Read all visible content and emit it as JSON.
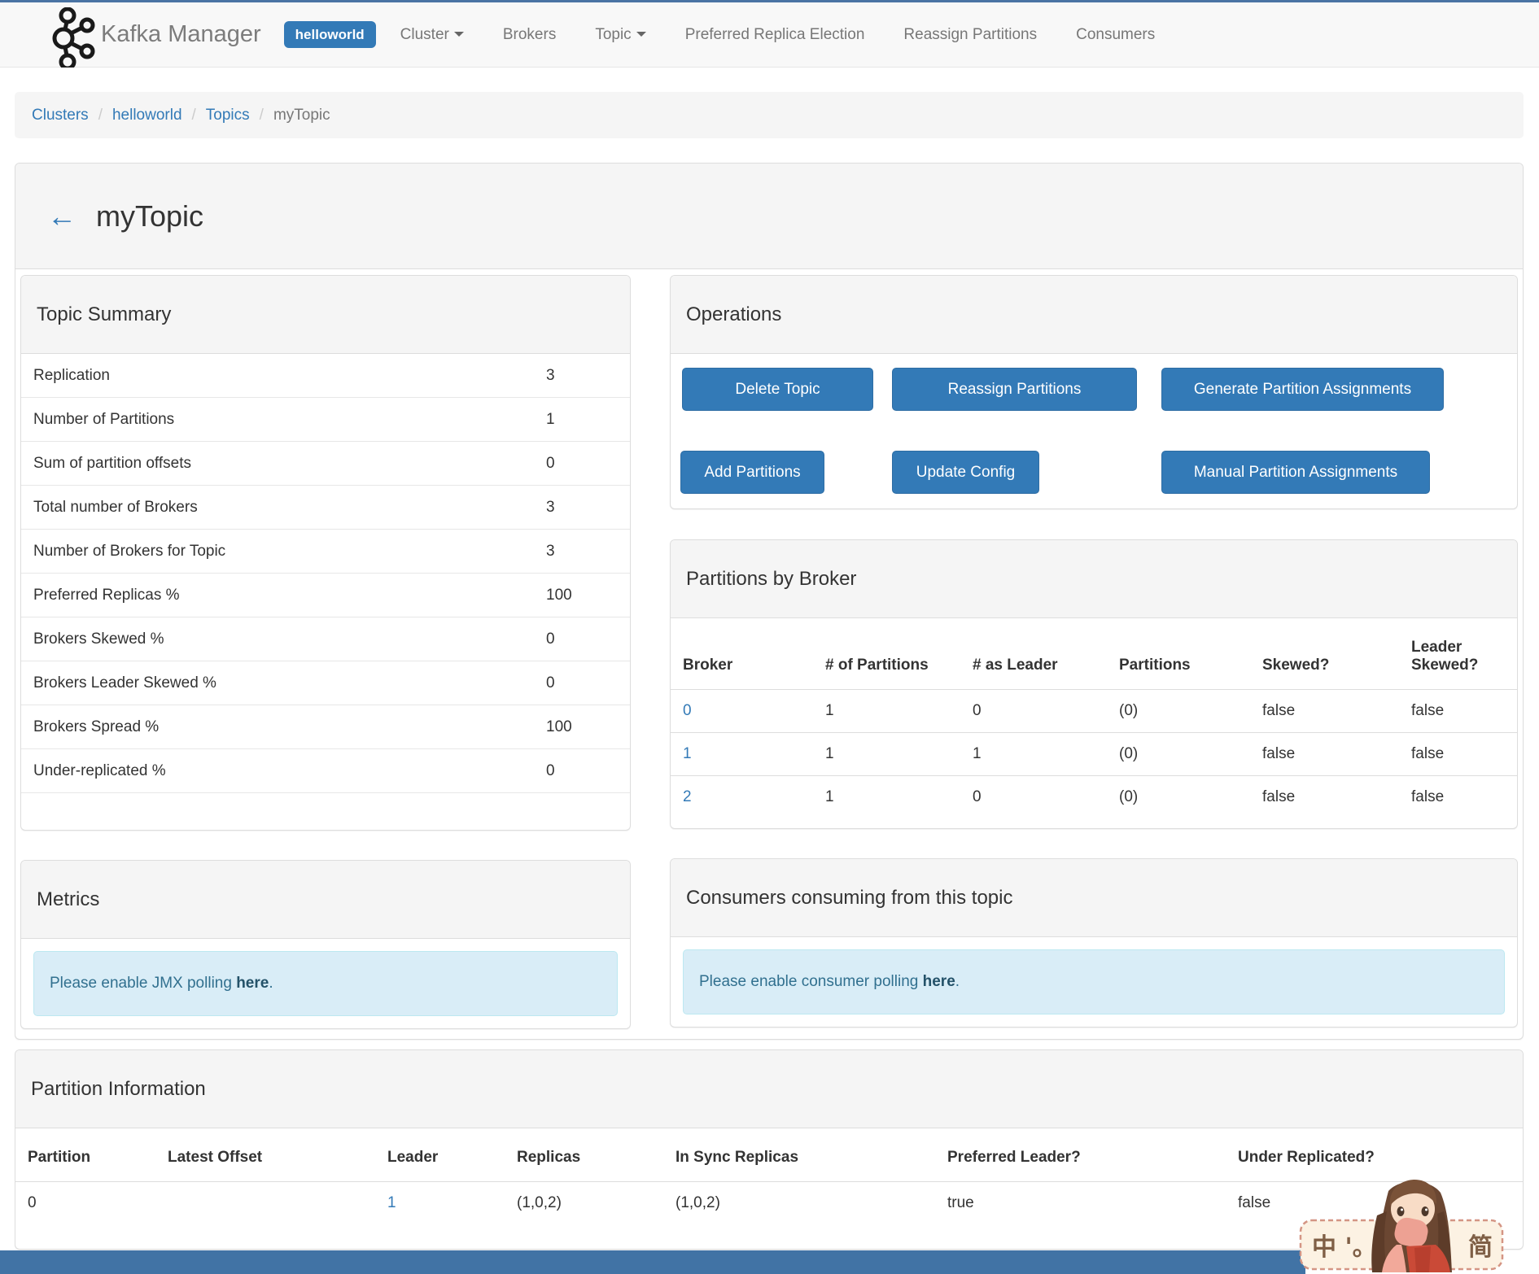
{
  "navbar": {
    "brand": "Kafka Manager",
    "cluster_badge": "helloworld",
    "items": [
      {
        "label": "Cluster",
        "dropdown": true
      },
      {
        "label": "Brokers",
        "dropdown": false
      },
      {
        "label": "Topic",
        "dropdown": true
      },
      {
        "label": "Preferred Replica Election",
        "dropdown": false
      },
      {
        "label": "Reassign Partitions",
        "dropdown": false
      },
      {
        "label": "Consumers",
        "dropdown": false
      }
    ]
  },
  "breadcrumb": {
    "separator": "/",
    "items": [
      {
        "label": "Clusters",
        "link": true
      },
      {
        "label": "helloworld",
        "link": true
      },
      {
        "label": "Topics",
        "link": true
      },
      {
        "label": "myTopic",
        "link": false
      }
    ]
  },
  "page": {
    "back_arrow": "←",
    "title": "myTopic"
  },
  "topic_summary": {
    "title": "Topic Summary",
    "rows": [
      {
        "label": "Replication",
        "value": "3"
      },
      {
        "label": "Number of Partitions",
        "value": "1"
      },
      {
        "label": "Sum of partition offsets",
        "value": "0"
      },
      {
        "label": "Total number of Brokers",
        "value": "3"
      },
      {
        "label": "Number of Brokers for Topic",
        "value": "3"
      },
      {
        "label": "Preferred Replicas %",
        "value": "100"
      },
      {
        "label": "Brokers Skewed %",
        "value": "0"
      },
      {
        "label": "Brokers Leader Skewed %",
        "value": "0"
      },
      {
        "label": "Brokers Spread %",
        "value": "100"
      },
      {
        "label": "Under-replicated %",
        "value": "0"
      }
    ]
  },
  "operations": {
    "title": "Operations",
    "buttons_row1": [
      "Delete Topic",
      "Reassign Partitions",
      "Generate Partition Assignments"
    ],
    "buttons_row2": [
      "Add Partitions",
      "Update Config",
      "Manual Partition Assignments"
    ]
  },
  "partitions_by_broker": {
    "title": "Partitions by Broker",
    "columns": [
      "Broker",
      "# of Partitions",
      "# as Leader",
      "Partitions",
      "Skewed?",
      "Leader Skewed?"
    ],
    "rows": [
      {
        "broker": "0",
        "num_partitions": "1",
        "as_leader": "0",
        "partitions": "(0)",
        "skewed": "false",
        "leader_skewed": "false"
      },
      {
        "broker": "1",
        "num_partitions": "1",
        "as_leader": "1",
        "partitions": "(0)",
        "skewed": "false",
        "leader_skewed": "false"
      },
      {
        "broker": "2",
        "num_partitions": "1",
        "as_leader": "0",
        "partitions": "(0)",
        "skewed": "false",
        "leader_skewed": "false"
      }
    ]
  },
  "metrics": {
    "title": "Metrics",
    "alert_prefix": "Please enable JMX polling ",
    "alert_link": "here",
    "alert_suffix": "."
  },
  "consumers": {
    "title": "Consumers consuming from this topic",
    "alert_prefix": "Please enable consumer polling ",
    "alert_link": "here",
    "alert_suffix": "."
  },
  "partition_information": {
    "title": "Partition Information",
    "columns": [
      "Partition",
      "Latest Offset",
      "Leader",
      "Replicas",
      "In Sync Replicas",
      "Preferred Leader?",
      "Under Replicated?"
    ],
    "rows": [
      {
        "partition": "0",
        "latest_offset": "",
        "leader": "1",
        "replicas": "(1,0,2)",
        "in_sync_replicas": "(1,0,2)",
        "preferred_leader": "true",
        "under_replicated": "false"
      }
    ]
  },
  "watermark": {
    "text_left": "中 '。半",
    "text_right": "简"
  },
  "colors": {
    "accent_blue": "#337ab7",
    "button_border": "#2e6da4",
    "navbar_bg": "#f8f8f8",
    "panel_header_bg": "#f5f5f5",
    "alert_bg": "#d9edf7",
    "alert_text": "#31708f",
    "bottom_bar": "#4173a5",
    "top_line": "#4a74a4"
  }
}
